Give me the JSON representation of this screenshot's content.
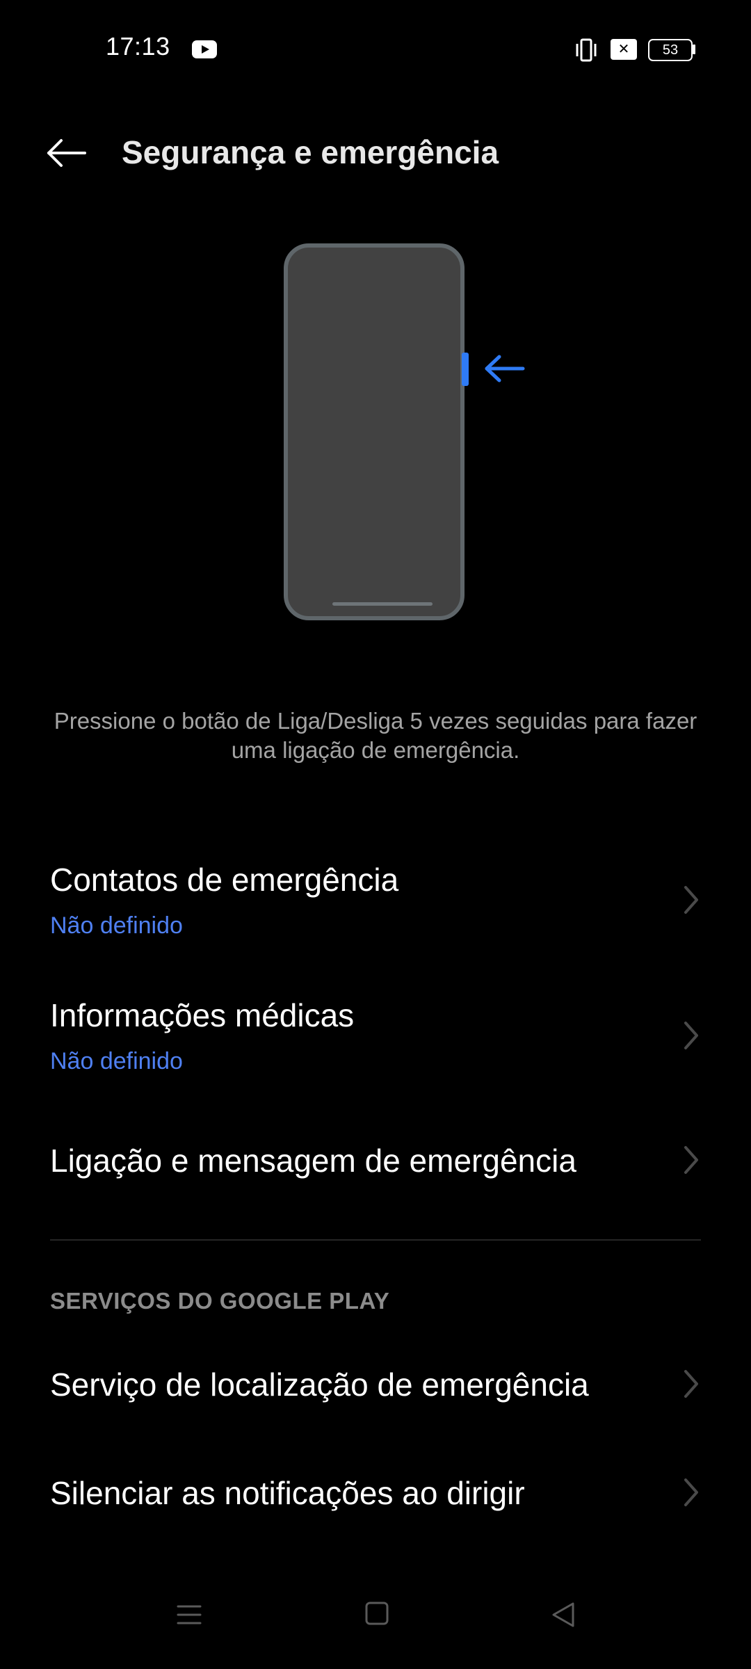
{
  "status_bar": {
    "time": "17:13",
    "battery_level": "53",
    "icons": [
      "youtube-icon",
      "vibrate-icon",
      "no-sim-icon",
      "battery-icon"
    ]
  },
  "header": {
    "title": "Segurança e emergência",
    "back_icon": "arrow-left-icon"
  },
  "illustration": {
    "accent_color": "#2F7BF5",
    "icons": [
      "phone-outline",
      "power-button-highlight",
      "arrow-left-pointer"
    ]
  },
  "description": "Pressione o botão de Liga/Desliga 5 vezes seguidas para fazer uma ligação de emergência.",
  "items": [
    {
      "title": "Contatos de emergência",
      "subtitle": "Não definido"
    },
    {
      "title": "Informações médicas",
      "subtitle": "Não definido"
    },
    {
      "title": "Ligação e mensagem de emergência"
    }
  ],
  "section_google": {
    "header": "SERVIÇOS DO GOOGLE PLAY",
    "items": [
      {
        "title": "Serviço de localização de emergência"
      },
      {
        "title": "Silenciar as notificações ao dirigir"
      }
    ]
  },
  "nav_bar": {
    "icons": [
      "menu-icon",
      "home-square-icon",
      "back-triangle-icon"
    ]
  },
  "colors": {
    "background": "#000000",
    "link": "#4F80F2",
    "accent": "#2F7BF5",
    "secondary_text": "#A4A4A4"
  }
}
